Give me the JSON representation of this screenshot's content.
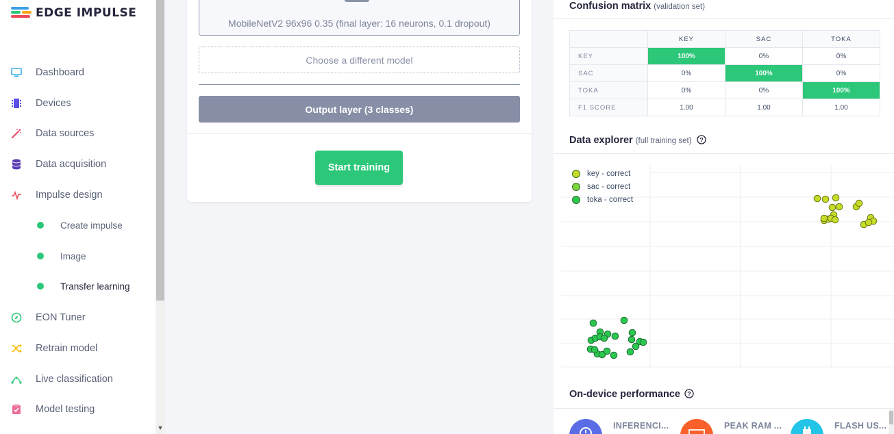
{
  "brand": {
    "name": "EDGE IMPULSE",
    "mark_colors": [
      "#3c9ee5",
      "#2cc779",
      "#f9a61a",
      "#ec4c5a"
    ]
  },
  "sidebar": {
    "items": [
      {
        "label": "Dashboard",
        "icon": "monitor-icon",
        "color": "#3cb0e8"
      },
      {
        "label": "Devices",
        "icon": "chip-icon",
        "color": "#5b4de6"
      },
      {
        "label": "Data sources",
        "icon": "magic-wand-icon",
        "color": "#ec4c6c"
      },
      {
        "label": "Data acquisition",
        "icon": "database-icon",
        "color": "#5b3bb5"
      },
      {
        "label": "Impulse design",
        "icon": "pulse-icon",
        "color": "#ec4c5a"
      }
    ],
    "subitems": [
      {
        "label": "Create impulse"
      },
      {
        "label": "Image"
      },
      {
        "label": "Transfer learning"
      }
    ],
    "items_after": [
      {
        "label": "EON Tuner",
        "icon": "compass-icon",
        "color": "#2cc779"
      },
      {
        "label": "Retrain model",
        "icon": "shuffle-icon",
        "color": "#f9c01a"
      },
      {
        "label": "Live classification",
        "icon": "live-icon",
        "color": "#2cc779"
      },
      {
        "label": "Model testing",
        "icon": "clipboard-check-icon",
        "color": "#ec6c9a"
      }
    ]
  },
  "training": {
    "model_text": "MobileNetV2 96x96 0.35 (final layer: 16 neurons, 0.1 dropout)",
    "choose_label": "Choose a different model",
    "output_layer_label": "Output layer (3 classes)",
    "start_label": "Start training"
  },
  "confusion": {
    "title": "Confusion matrix",
    "subtitle": "(validation set)",
    "columns": [
      "KEY",
      "SAC",
      "TOKA"
    ],
    "rows": [
      {
        "label": "KEY",
        "cells": [
          "100%",
          "0%",
          "0%"
        ]
      },
      {
        "label": "SAC",
        "cells": [
          "0%",
          "100%",
          "0%"
        ]
      },
      {
        "label": "TOKA",
        "cells": [
          "0%",
          "0%",
          "100%"
        ]
      },
      {
        "label": "F1 SCORE",
        "cells": [
          "1.00",
          "1.00",
          "1.00"
        ]
      }
    ]
  },
  "explorer": {
    "title": "Data explorer",
    "subtitle": "(full training set)",
    "help_icon": "question-circle-icon",
    "legend": [
      {
        "label": "key - correct",
        "color": "#c6dc28"
      },
      {
        "label": "sac - correct",
        "color": "#7ad43c"
      },
      {
        "label": "toka - correct",
        "color": "#2cc74f"
      }
    ]
  },
  "performance": {
    "title": "On-device performance",
    "help_icon": "question-circle-icon",
    "metrics": [
      {
        "label": "INFERENCI...",
        "icon": "clock-icon",
        "color": "#5b6de6"
      },
      {
        "label": "PEAK RAM ...",
        "icon": "ram-icon",
        "color": "#f9602a"
      },
      {
        "label": "FLASH US...",
        "icon": "flash-chip-icon",
        "color": "#22c4e8"
      }
    ]
  }
}
